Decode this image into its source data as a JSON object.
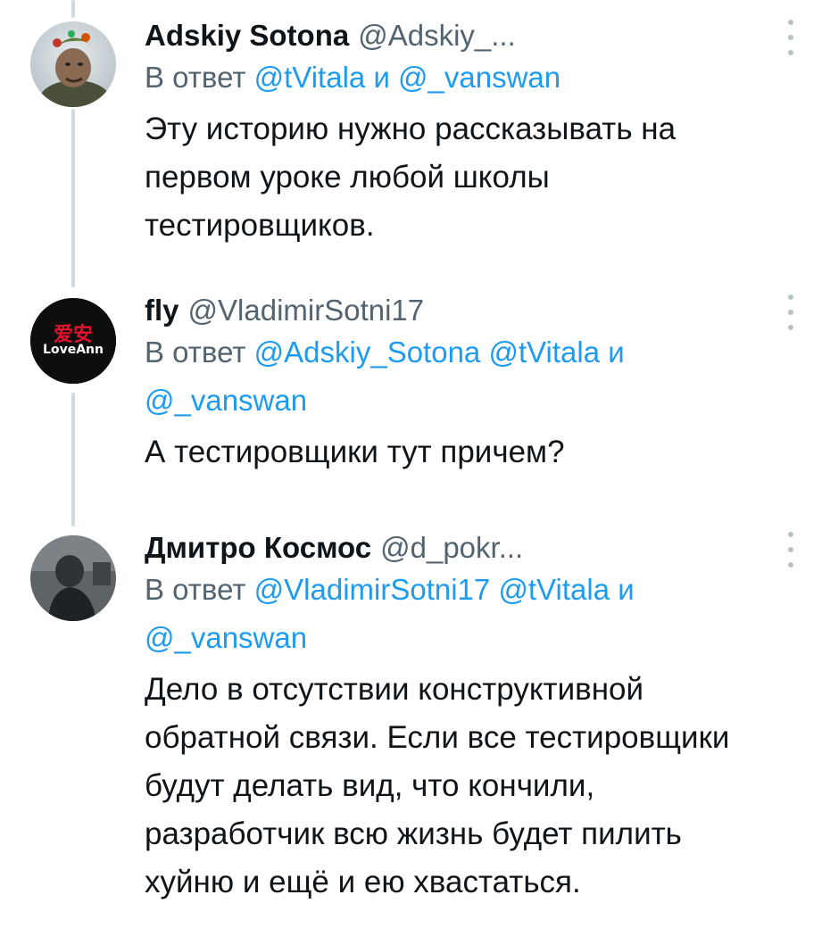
{
  "tweets": [
    {
      "name": "Adskiy Sotona",
      "handle": "@Adskiy_...",
      "reply_prefix": "В ответ",
      "reply_mentions": [
        "@tVitala",
        "и",
        "@_vanswan"
      ],
      "text_lines": [
        "Эту историю нужно рассказывать на",
        "первом уроке любой школы",
        "тестировщиков."
      ],
      "more_icon": "more-vertical-icon"
    },
    {
      "name": "fly",
      "handle": "@VladimirSotni17",
      "reply_prefix": "В ответ",
      "reply_mentions_line1": [
        "@Adskiy_Sotona",
        "@tVitala",
        "и"
      ],
      "reply_mentions_line2": [
        "@_vanswan"
      ],
      "avatar_text": "LoveAnn",
      "avatar_glyphs": "爱安",
      "text_lines": [
        "А тестировщики тут причем?"
      ],
      "more_icon": "more-vertical-icon"
    },
    {
      "name": "Дмитро Космос",
      "handle": "@d_pokr...",
      "reply_prefix": "В ответ",
      "reply_mentions_line1": [
        "@VladimirSotni17",
        "@tVitala",
        "и"
      ],
      "reply_mentions_line2": [
        "@_vanswan"
      ],
      "text_lines": [
        "Дело в отсутствии конструктивной",
        "обратной связи. Если все тестировщики",
        "будут делать вид, что кончили,",
        "разработчик всю жизнь будет пилить",
        "хуйню и ещё и ею хвастаться."
      ],
      "more_icon": "more-vertical-icon"
    }
  ],
  "colors": {
    "text": "#0f1419",
    "secondary": "#536471",
    "link": "#1d9bf0",
    "thread_line": "#cfd9de"
  }
}
